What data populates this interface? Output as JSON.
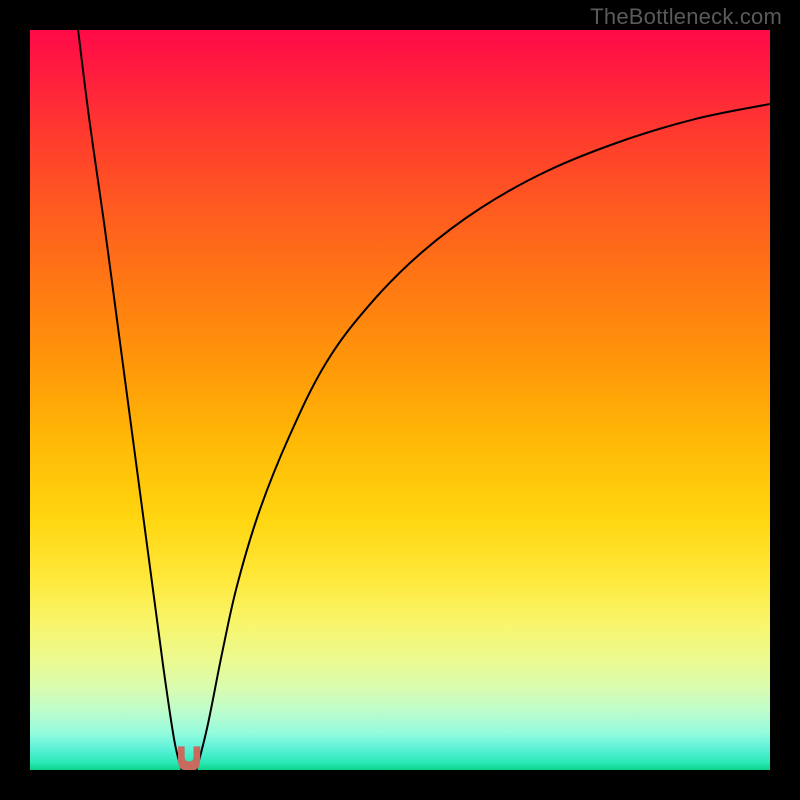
{
  "attribution": "TheBottleneck.com",
  "colors": {
    "frame": "#000000",
    "curve_stroke": "#000000",
    "marker_fill": "#c96a5f",
    "gradient_top": "#ff0a47",
    "gradient_bottom": "#0cd389",
    "attribution_text": "#5a5a5a"
  },
  "chart_data": {
    "type": "line",
    "title": "",
    "xlabel": "",
    "ylabel": "",
    "xlim": [
      0,
      100
    ],
    "ylim": [
      0,
      100
    ],
    "grid": false,
    "legend": false,
    "annotations": [],
    "series": [
      {
        "name": "left-branch",
        "x": [
          6.5,
          8,
          10,
          12,
          14,
          16,
          18,
          19.5,
          20.5
        ],
        "y": [
          100,
          88,
          74,
          59,
          44,
          29,
          14,
          4,
          0
        ]
      },
      {
        "name": "right-branch",
        "x": [
          22.5,
          24,
          26,
          28,
          31,
          35,
          40,
          46,
          53,
          61,
          70,
          80,
          90,
          100
        ],
        "y": [
          0,
          6,
          16,
          25,
          35,
          45,
          55,
          63,
          70,
          76,
          81,
          85,
          88,
          90
        ]
      }
    ],
    "marker": {
      "shape": "u",
      "x_center": 21.5,
      "y_bottom": 0,
      "width": 3.0,
      "height": 3.2,
      "color": "#c96a5f"
    }
  }
}
